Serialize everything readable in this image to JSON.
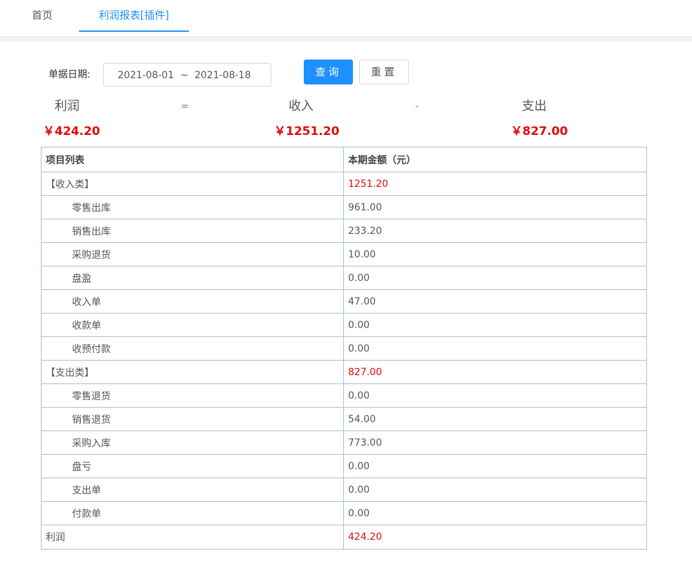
{
  "tabs": [
    {
      "label": "首页"
    },
    {
      "label": "利润报表[插件]"
    }
  ],
  "filter": {
    "label": "单据日期:",
    "start_date": "2021-08-01",
    "separator": "~",
    "end_date": "2021-08-18",
    "query_label": "查询",
    "reset_label": "重置"
  },
  "summary": {
    "profit_label": "利润",
    "eq": "=",
    "income_label": "收入",
    "minus": "-",
    "expense_label": "支出",
    "profit_value": "￥424.20",
    "income_value": "￥1251.20",
    "expense_value": "￥827.00"
  },
  "table": {
    "headers": [
      "项目列表",
      "本期金额（元）"
    ],
    "rows": [
      {
        "label": "【收入类】",
        "value": "1251.20"
      },
      {
        "label": "零售出库",
        "value": "961.00"
      },
      {
        "label": "销售出库",
        "value": "233.20"
      },
      {
        "label": "采购退货",
        "value": "10.00"
      },
      {
        "label": "盘盈",
        "value": "0.00"
      },
      {
        "label": "收入单",
        "value": "47.00"
      },
      {
        "label": "收款单",
        "value": "0.00"
      },
      {
        "label": "收预付款",
        "value": "0.00"
      },
      {
        "label": "【支出类】",
        "value": "827.00"
      },
      {
        "label": "零售退货",
        "value": "0.00"
      },
      {
        "label": "销售退货",
        "value": "54.00"
      },
      {
        "label": "采购入库",
        "value": "773.00"
      },
      {
        "label": "盘亏",
        "value": "0.00"
      },
      {
        "label": "支出单",
        "value": "0.00"
      },
      {
        "label": "付款单",
        "value": "0.00"
      },
      {
        "label": "利润",
        "value": "424.20"
      }
    ]
  },
  "colors": {
    "accent": "#1e90ff",
    "highlight": "#e4080a",
    "table_border": "#a9bdd8"
  }
}
